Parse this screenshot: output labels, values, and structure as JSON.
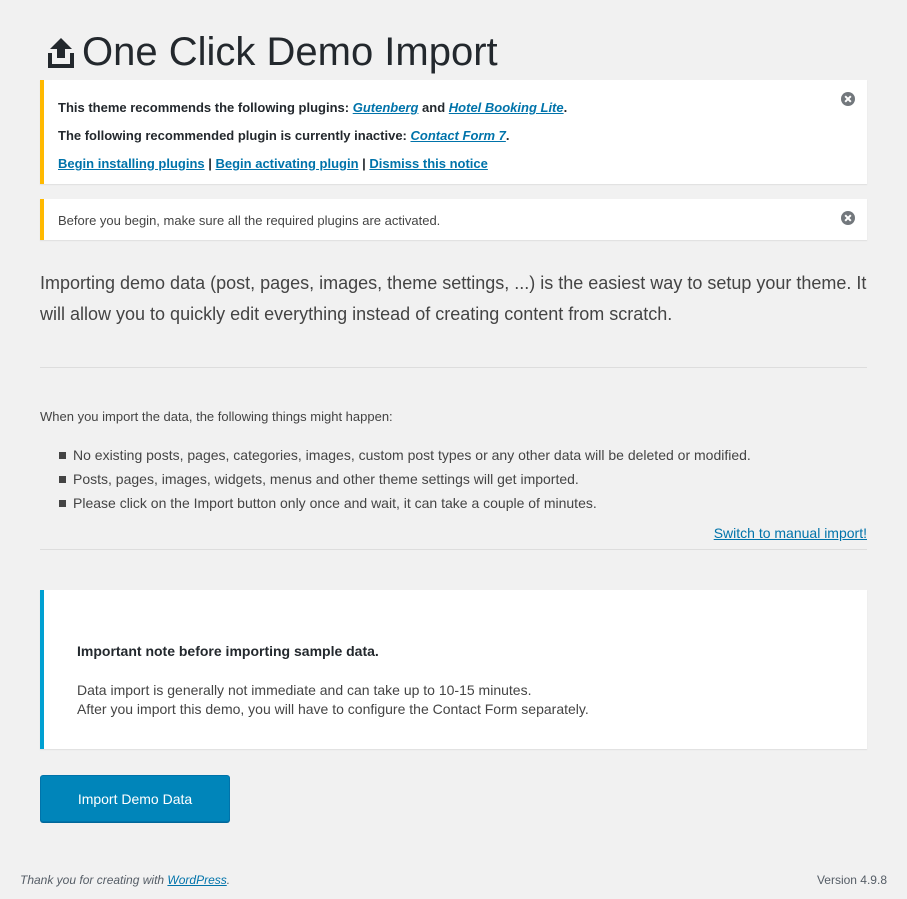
{
  "page": {
    "title": "One Click Demo Import",
    "icon": "upload-icon"
  },
  "notices": {
    "plugins": {
      "line1_prefix": "This theme recommends the following plugins: ",
      "plugin1": "Gutenberg",
      "line1_and": " and ",
      "plugin2": "Hotel Booking Lite",
      "line1_suffix": ".",
      "line2_prefix": "The following recommended plugin is currently inactive: ",
      "plugin3": "Contact Form 7",
      "line2_suffix": ".",
      "action1": "Begin installing plugins",
      "sep": " | ",
      "action2": "Begin activating plugin",
      "action3": "Dismiss this notice",
      "accent": "#ffb900"
    },
    "before": {
      "text": "Before you begin, make sure all the required plugins are activated.",
      "accent": "#ffb900"
    }
  },
  "intro": "Importing demo data (post, pages, images, theme settings, ...) is the easiest way to setup your theme. It will allow you to quickly edit everything instead of creating content from scratch.",
  "happen": {
    "heading": "When you import the data, the following things might happen:",
    "items": [
      "No existing posts, pages, categories, images, custom post types or any other data will be deleted or modified.",
      "Posts, pages, images, widgets, menus and other theme settings will get imported.",
      "Please click on the Import button only once and wait, it can take a couple of minutes."
    ]
  },
  "manual_link": "Switch to manual import!",
  "note": {
    "title": "Important note before importing sample data.",
    "line1": "Data import is generally not immediate and can take up to 10-15 minutes.",
    "line2": "After you import this demo, you will have to configure the Contact Form separately.",
    "accent": "#00a0d2"
  },
  "import_button": "Import Demo Data",
  "footer": {
    "thanks_prefix": "Thank you for creating with ",
    "thanks_link": "WordPress",
    "thanks_suffix": ".",
    "version": "Version 4.9.8"
  }
}
